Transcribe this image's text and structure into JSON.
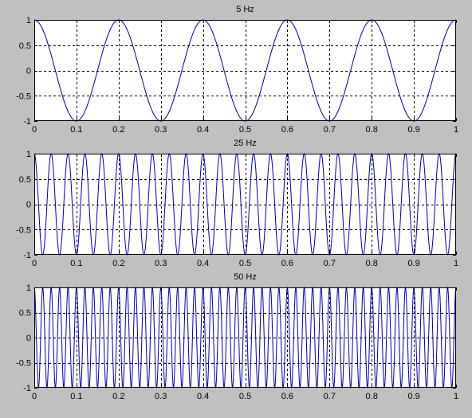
{
  "figure_background": "#c0c0c0",
  "axes_background": "#ffffff",
  "line_color": "#0000a0",
  "grid_color": "#000000",
  "chart_data": [
    {
      "type": "line",
      "title": "5 Hz",
      "xlabel": "",
      "ylabel": "",
      "frequency_hz": 5,
      "function": "cos(2*pi*f*t)",
      "xlim": [
        0,
        1
      ],
      "ylim": [
        -1,
        1
      ],
      "xticks": [
        0,
        0.1,
        0.2,
        0.3,
        0.4,
        0.5,
        0.6,
        0.7,
        0.8,
        0.9,
        1
      ],
      "xtick_labels": [
        "0",
        "0.1",
        "0.2",
        "0.3",
        "0.4",
        "0.5",
        "0.6",
        "0.7",
        "0.8",
        "0.9",
        "1"
      ],
      "yticks": [
        -1,
        -0.5,
        0,
        0.5,
        1
      ],
      "ytick_labels": [
        "-1",
        "-0.5",
        "0",
        "0.5",
        "1"
      ],
      "grid": true,
      "grid_style": "dashed"
    },
    {
      "type": "line",
      "title": "25 Hz",
      "xlabel": "",
      "ylabel": "",
      "frequency_hz": 25,
      "function": "cos(2*pi*f*t)",
      "xlim": [
        0,
        1
      ],
      "ylim": [
        -1,
        1
      ],
      "xticks": [
        0,
        0.1,
        0.2,
        0.3,
        0.4,
        0.5,
        0.6,
        0.7,
        0.8,
        0.9,
        1
      ],
      "xtick_labels": [
        "0",
        "0.1",
        "0.2",
        "0.3",
        "0.4",
        "0.5",
        "0.6",
        "0.7",
        "0.8",
        "0.9",
        "1"
      ],
      "yticks": [
        -1,
        -0.5,
        0,
        0.5,
        1
      ],
      "ytick_labels": [
        "-1",
        "-0.5",
        "0",
        "0.5",
        "1"
      ],
      "grid": true,
      "grid_style": "dashed"
    },
    {
      "type": "line",
      "title": "50 Hz",
      "xlabel": "",
      "ylabel": "",
      "frequency_hz": 50,
      "function": "cos(2*pi*f*t)",
      "xlim": [
        0,
        1
      ],
      "ylim": [
        -1,
        1
      ],
      "xticks": [
        0,
        0.1,
        0.2,
        0.3,
        0.4,
        0.5,
        0.6,
        0.7,
        0.8,
        0.9,
        1
      ],
      "xtick_labels": [
        "0",
        "0.1",
        "0.2",
        "0.3",
        "0.4",
        "0.5",
        "0.6",
        "0.7",
        "0.8",
        "0.9",
        "1"
      ],
      "yticks": [
        -1,
        -0.5,
        0,
        0.5,
        1
      ],
      "ytick_labels": [
        "-1",
        "-0.5",
        "0",
        "0.5",
        "1"
      ],
      "grid": true,
      "grid_style": "dashed"
    }
  ]
}
